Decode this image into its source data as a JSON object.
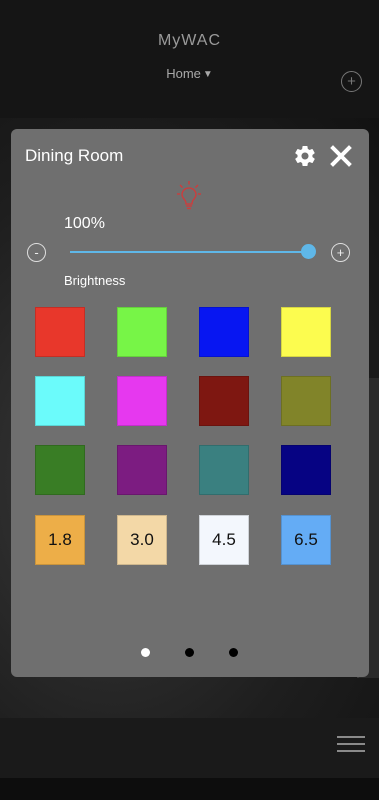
{
  "header": {
    "brand": "MyWAC",
    "location": "Home"
  },
  "modal": {
    "title": "Dining Room",
    "brightness_value": "100%",
    "brightness_label": "Brightness",
    "brightness_level": 1.0,
    "minus": "-",
    "plus": "+",
    "colors": [
      "#e8372b",
      "#77f547",
      "#0716f2",
      "#fcfc4f",
      "#6bfbfb",
      "#e638ef",
      "#7e1711",
      "#818429",
      "#397d25",
      "#7c1c81",
      "#3a8080",
      "#060383"
    ],
    "temperatures": [
      {
        "label": "1.8",
        "color": "#edae48"
      },
      {
        "label": "3.0",
        "color": "#f3d8a7"
      },
      {
        "label": "4.5",
        "color": "#f3f7fd"
      },
      {
        "label": "6.5",
        "color": "#64acf5"
      }
    ],
    "pages": 3,
    "active_page": 0
  },
  "icons": {
    "settings": "gear-icon",
    "close": "close-icon",
    "bulb": "lightbulb-icon",
    "menu": "hamburger-menu-icon",
    "add": "plus-icon"
  }
}
